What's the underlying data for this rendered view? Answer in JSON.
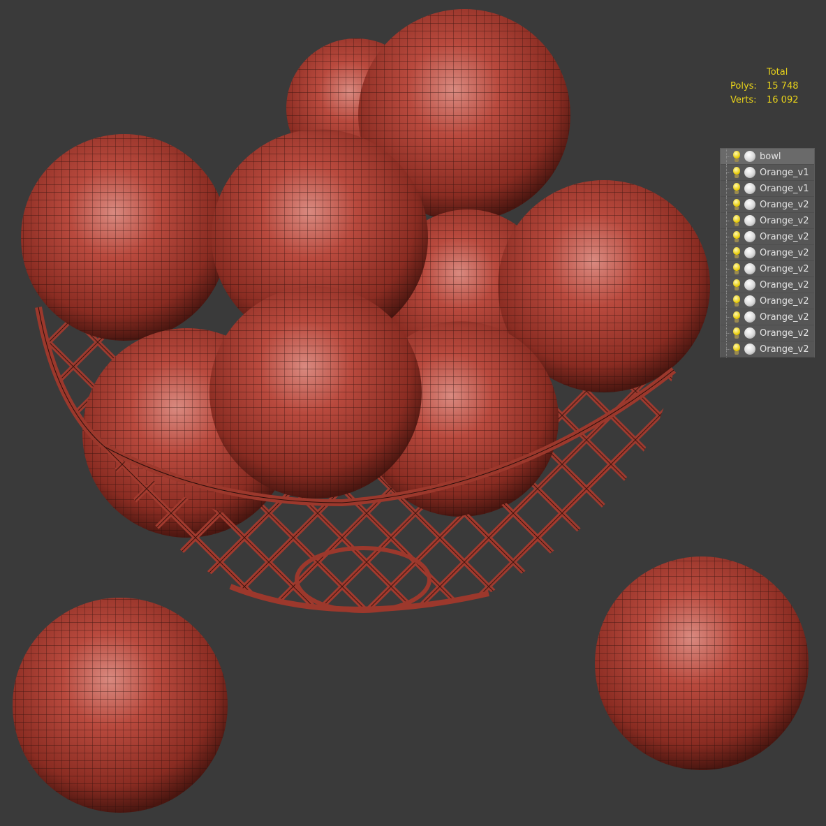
{
  "stats": {
    "header": "Total",
    "polys_label": "Polys:",
    "polys_value": "15 748",
    "verts_label": "Verts:",
    "verts_value": "16 092"
  },
  "layers": [
    {
      "name": "bowl",
      "icon": "light-bulb-icon",
      "material": "sphere-material-icon"
    },
    {
      "name": "Orange_v1",
      "icon": "light-bulb-icon",
      "material": "sphere-material-icon"
    },
    {
      "name": "Orange_v1",
      "icon": "light-bulb-icon",
      "material": "sphere-material-icon"
    },
    {
      "name": "Orange_v2",
      "icon": "light-bulb-icon",
      "material": "sphere-material-icon"
    },
    {
      "name": "Orange_v2",
      "icon": "light-bulb-icon",
      "material": "sphere-material-icon"
    },
    {
      "name": "Orange_v2",
      "icon": "light-bulb-icon",
      "material": "sphere-material-icon"
    },
    {
      "name": "Orange_v2",
      "icon": "light-bulb-icon",
      "material": "sphere-material-icon"
    },
    {
      "name": "Orange_v2",
      "icon": "light-bulb-icon",
      "material": "sphere-material-icon"
    },
    {
      "name": "Orange_v2",
      "icon": "light-bulb-icon",
      "material": "sphere-material-icon"
    },
    {
      "name": "Orange_v2",
      "icon": "light-bulb-icon",
      "material": "sphere-material-icon"
    },
    {
      "name": "Orange_v2",
      "icon": "light-bulb-icon",
      "material": "sphere-material-icon"
    },
    {
      "name": "Orange_v2",
      "icon": "light-bulb-icon",
      "material": "sphere-material-icon"
    },
    {
      "name": "Orange_v2",
      "icon": "light-bulb-icon",
      "material": "sphere-material-icon"
    }
  ],
  "colors": {
    "background": "#3a3a3a",
    "fruit": "#b8483c",
    "stats_text": "#e8d21a",
    "wireframe": "#2a0f0b"
  }
}
